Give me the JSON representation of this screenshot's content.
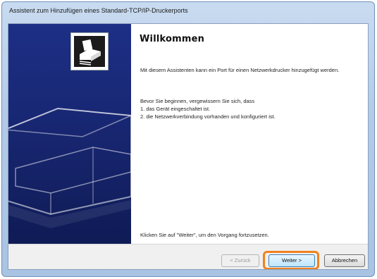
{
  "window": {
    "title": "Assistent zum Hinzufügen eines Standard-TCP/IP-Druckerports"
  },
  "content": {
    "heading": "Willkommen",
    "intro": "Mit diesem Assistenten kann ein Port für einen Netzwerkdrucker hinzugefügt werden.",
    "before_label": "Bevor Sie beginnen, vergewissern Sie sich, dass",
    "checklist": [
      "1.  das Gerät eingeschaltet ist.",
      "2.  die Netzwerkverbindung vorhanden und konfiguriert ist."
    ],
    "continue_hint": "Klicken Sie auf \"Weiter\", um den Vorgang fortzusetzen."
  },
  "buttons": {
    "back": "< Zurück",
    "next": "Weiter >",
    "cancel": "Abbrechen"
  },
  "highlight_color": "#f0821e",
  "side_panel_color": "#1d2f86",
  "icons": [
    "printer-wizard-icon"
  ]
}
